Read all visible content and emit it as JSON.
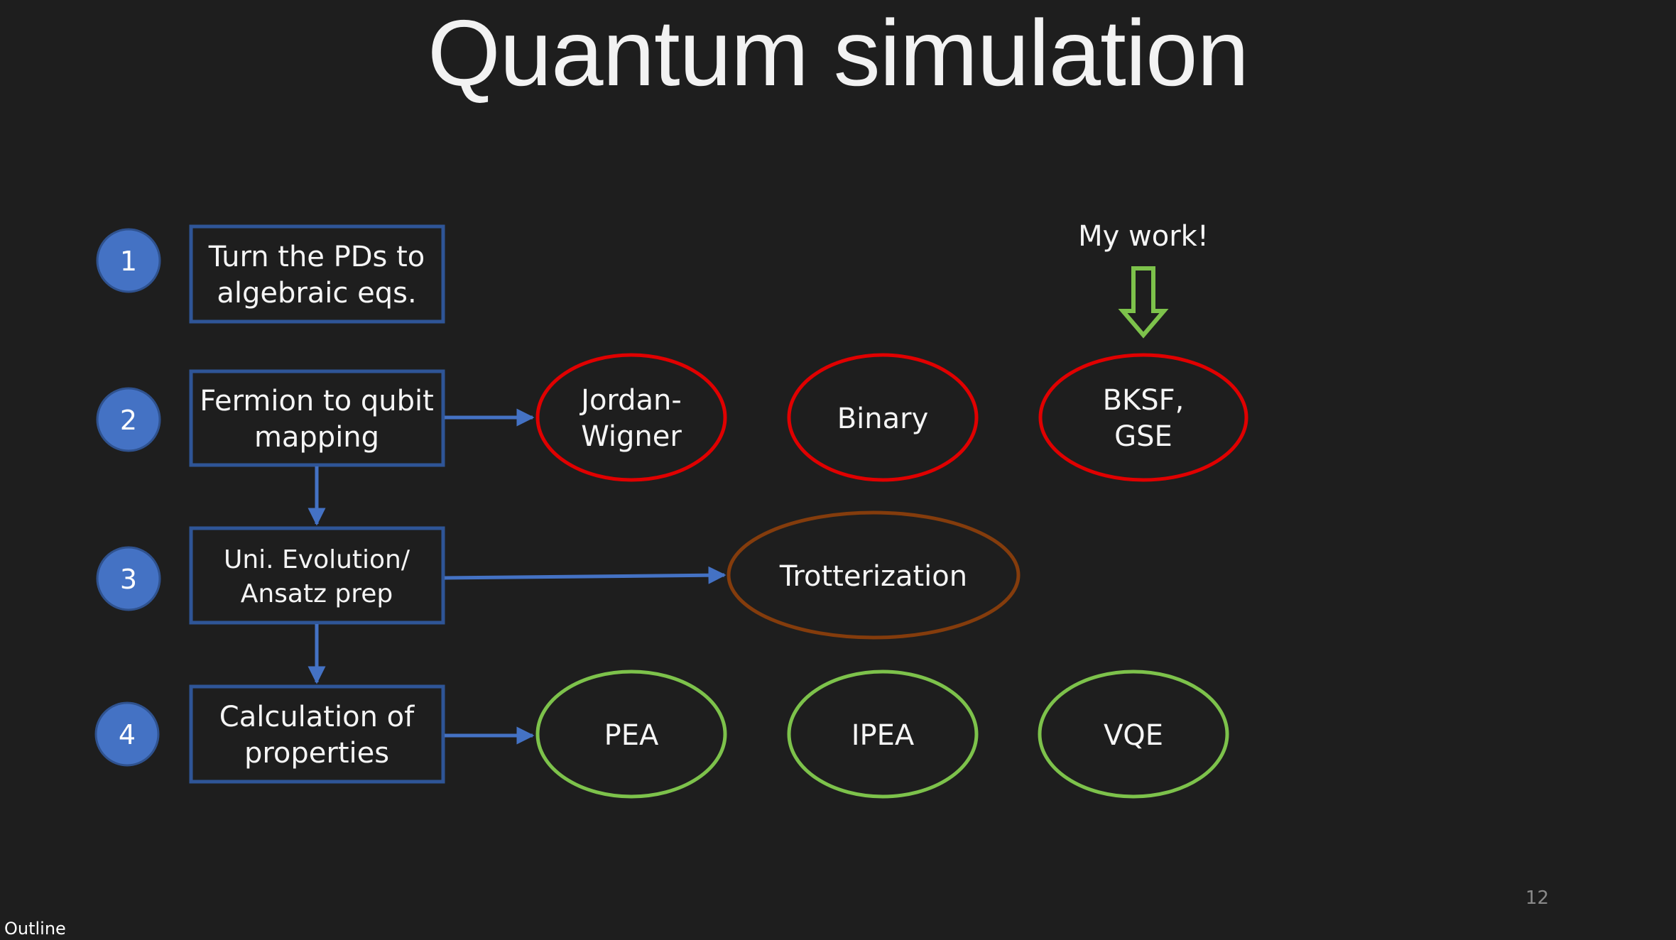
{
  "title": "Quantum simulation",
  "steps": [
    {
      "number": "1",
      "lines": [
        "Turn the PDs to",
        "algebraic eqs."
      ]
    },
    {
      "number": "2",
      "lines": [
        "Fermion to qubit",
        "mapping"
      ]
    },
    {
      "number": "3",
      "lines": [
        "Uni. Evolution/",
        "Ansatz prep"
      ]
    },
    {
      "number": "4",
      "lines": [
        "Calculation of",
        "properties"
      ]
    }
  ],
  "mappings": [
    {
      "lines": [
        "Jordan-",
        "Wigner"
      ]
    },
    {
      "lines": [
        "Binary"
      ]
    },
    {
      "lines": [
        "BKSF,",
        "GSE"
      ]
    }
  ],
  "evolution": {
    "lines": [
      "Trotterization"
    ]
  },
  "properties": [
    {
      "lines": [
        "PEA"
      ]
    },
    {
      "lines": [
        "IPEA"
      ]
    },
    {
      "lines": [
        "VQE"
      ]
    }
  ],
  "callout": "My work!",
  "footer": {
    "outline": "Outline",
    "page_number": "12"
  },
  "colors": {
    "background": "#1e1e1e",
    "step_circle": "#4472c4",
    "box_border": "#2f5597",
    "connector": "#4472c4",
    "mapping_ellipse": "#e00000",
    "evolution_ellipse": "#843c0c",
    "property_ellipse": "#7dc24b",
    "callout_arrow": "#7dc24b"
  }
}
